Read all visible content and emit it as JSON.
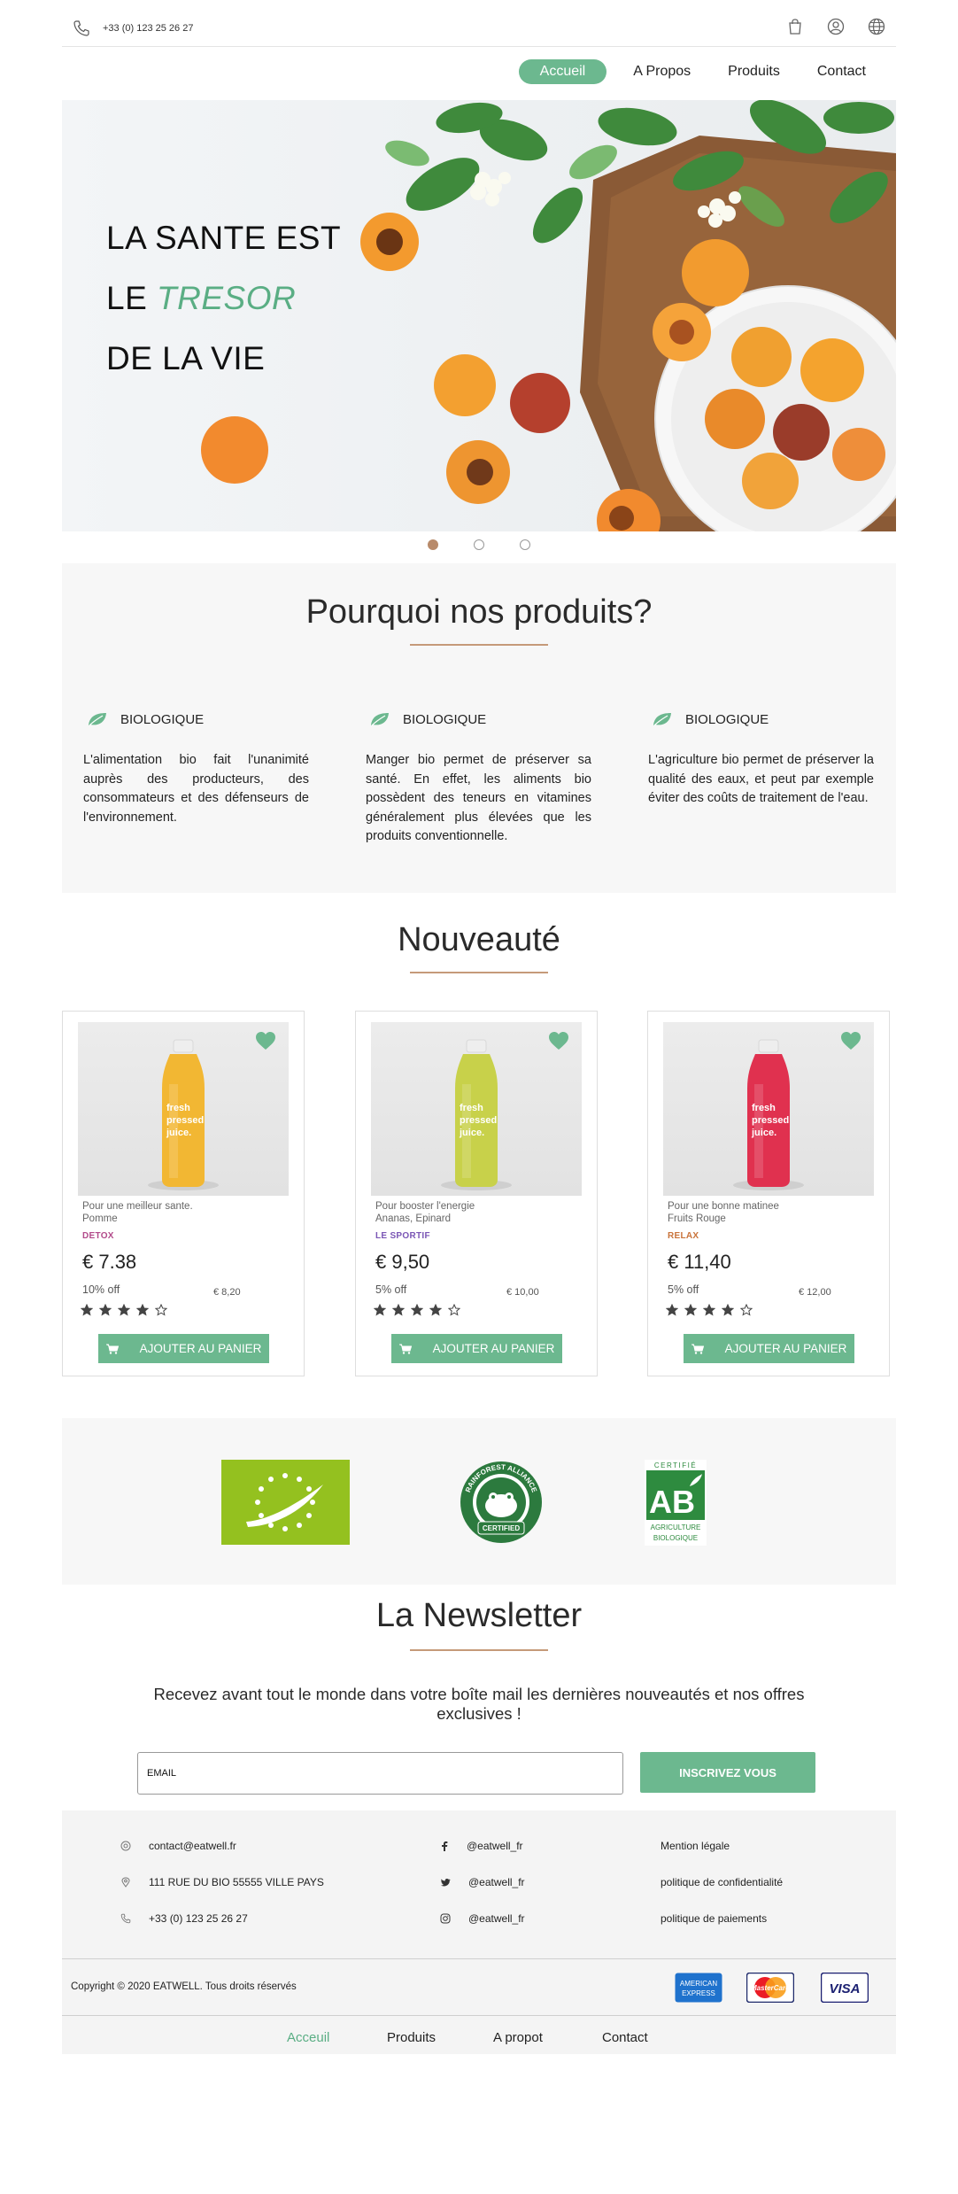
{
  "header": {
    "phone": "+33 (0) 123 25 26 27",
    "icons": [
      "bag-icon",
      "user-icon",
      "globe-icon"
    ]
  },
  "nav": {
    "items": [
      {
        "label": "Accueil",
        "active": true
      },
      {
        "label": "A Propos",
        "active": false
      },
      {
        "label": "Produits",
        "active": false
      },
      {
        "label": "Contact",
        "active": false
      }
    ]
  },
  "hero": {
    "line1": "LA SANTE EST",
    "line2_prefix": "LE",
    "line2_accent": "TRESOR",
    "line3": "DE LA VIE",
    "slides_count": 3,
    "active_slide": 1
  },
  "why": {
    "title": "Pourquoi nos produits?",
    "features": [
      {
        "title": "BIOLOGIQUE",
        "text": "L'alimentation bio fait l'unanimité auprès des producteurs, des consommateurs et des défenseurs de l'environnement."
      },
      {
        "title": "BIOLOGIQUE",
        "text": "Manger bio permet de préserver sa santé. En effet, les aliments bio possèdent des teneurs en vitamines généralement plus élevées que les produits conventionnelle."
      },
      {
        "title": "BIOLOGIQUE",
        "text": "L'agriculture bio permet de préserver la qualité des eaux, et peut par exemple éviter des coûts de traitement de l'eau."
      }
    ]
  },
  "products": {
    "title": "Nouveauté",
    "items": [
      {
        "subtitle1": "Pour une meilleur sante.",
        "subtitle2": "Pomme",
        "tag": "DETOX",
        "tag_color": "#b24a8a",
        "price": "€ 7.38",
        "discount": "10% off",
        "old_price": "€ 8,20",
        "rating": 4,
        "bottle_color": "#f2b733",
        "button": "AJOUTER AU PANIER"
      },
      {
        "subtitle1": "Pour booster l'energie",
        "subtitle2": "Ananas, Epinard",
        "tag": "LE SPORTIF",
        "tag_color": "#7a56b5",
        "price": "€ 9,50",
        "discount": "5% off",
        "old_price": "€ 10,00",
        "rating": 4,
        "bottle_color": "#c8d14a",
        "button": "AJOUTER AU PANIER"
      },
      {
        "subtitle1": "Pour une bonne matinee",
        "subtitle2": "Fruits Rouge",
        "tag": "RELAX",
        "tag_color": "#c9733a",
        "price": "€ 11,40",
        "discount": "5% off",
        "old_price": "€ 12,00",
        "rating": 4,
        "bottle_color": "#e0314f",
        "button": "AJOUTER AU PANIER"
      }
    ],
    "bottle_text": [
      "fresh",
      "pressed",
      "juice."
    ]
  },
  "certifications": {
    "rainforest_text": "RAINFOREST ALLIANCE",
    "rainforest_certified": "CERTIFIED",
    "ab_top": "CERTIFIÉ",
    "ab_logo": "AB",
    "ab_bottom1": "AGRICULTURE",
    "ab_bottom2": "BIOLOGIQUE",
    "eu_color": "#94c11f"
  },
  "newsletter": {
    "title": "La Newsletter",
    "subtitle": "Recevez avant tout le monde dans votre boîte mail les dernières nouveautés et nos offres exclusives !",
    "email_placeholder": "EMAIL",
    "button": "INSCRIVEZ VOUS"
  },
  "footer": {
    "contact": [
      {
        "icon": "at-icon",
        "text": "contact@eatwell.fr"
      },
      {
        "icon": "pin-icon",
        "text": "111 RUE DU BIO 55555 VILLE PAYS"
      },
      {
        "icon": "phone-icon",
        "text": "+33 (0) 123 25 26 27"
      }
    ],
    "social": [
      {
        "icon": "facebook-icon",
        "text": "@eatwell_fr"
      },
      {
        "icon": "twitter-icon",
        "text": "@eatwell_fr"
      },
      {
        "icon": "instagram-icon",
        "text": "@eatwell_fr"
      }
    ],
    "legal": [
      "Mention légale",
      "politique de confidentialité",
      "politique de paiements"
    ],
    "copyright": "Copyright © 2020 EATWELL. Tous droits réservés",
    "payments": {
      "amex1": "AMERICAN",
      "amex2": "EXPRESS",
      "mastercard": "MasterCard",
      "visa": "VISA"
    },
    "nav": [
      {
        "label": "Acceuil",
        "active": true
      },
      {
        "label": "Produits",
        "active": false
      },
      {
        "label": "A propot",
        "active": false
      },
      {
        "label": "Contact",
        "active": false
      }
    ]
  },
  "colors": {
    "accent": "#6cb88f",
    "underline": "#c59a79"
  }
}
